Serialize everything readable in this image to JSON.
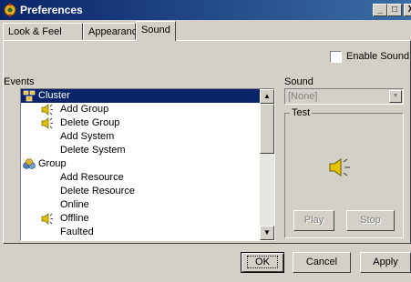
{
  "window": {
    "title": "Preferences",
    "controls": {
      "minimize": "_",
      "maximize": "□",
      "close": "X"
    }
  },
  "tabs": [
    {
      "label": "Look & Feel",
      "active": false
    },
    {
      "label": "Appearance",
      "active": false
    },
    {
      "label": "Sound",
      "active": true
    }
  ],
  "enable_sound": {
    "label": "Enable Sound",
    "checked": false
  },
  "events": {
    "label": "Events",
    "items": [
      {
        "label": "Cluster",
        "level": 0,
        "icon": "cluster-icon",
        "selected": true
      },
      {
        "label": "Add Group",
        "level": 1,
        "icon": "speaker-icon",
        "selected": false
      },
      {
        "label": "Delete Group",
        "level": 1,
        "icon": "speaker-icon",
        "selected": false
      },
      {
        "label": "Add System",
        "level": 1,
        "icon": "",
        "selected": false
      },
      {
        "label": "Delete System",
        "level": 1,
        "icon": "",
        "selected": false
      },
      {
        "label": "Group",
        "level": 0,
        "icon": "group-icon",
        "selected": false
      },
      {
        "label": "Add Resource",
        "level": 1,
        "icon": "",
        "selected": false
      },
      {
        "label": "Delete Resource",
        "level": 1,
        "icon": "",
        "selected": false
      },
      {
        "label": "Online",
        "level": 1,
        "icon": "",
        "selected": false
      },
      {
        "label": "Offline",
        "level": 1,
        "icon": "speaker-icon",
        "selected": false
      },
      {
        "label": "Faulted",
        "level": 1,
        "icon": "",
        "selected": false
      }
    ]
  },
  "sound": {
    "label": "Sound",
    "selected_value": "[None]",
    "test_group_label": "Test",
    "play_label": "Play",
    "stop_label": "Stop"
  },
  "footer": {
    "ok_label": "OK",
    "cancel_label": "Cancel",
    "apply_label": "Apply"
  },
  "colors": {
    "title_bar": "#0a246a",
    "selection": "#0a246a",
    "face": "#d4d0c8"
  }
}
